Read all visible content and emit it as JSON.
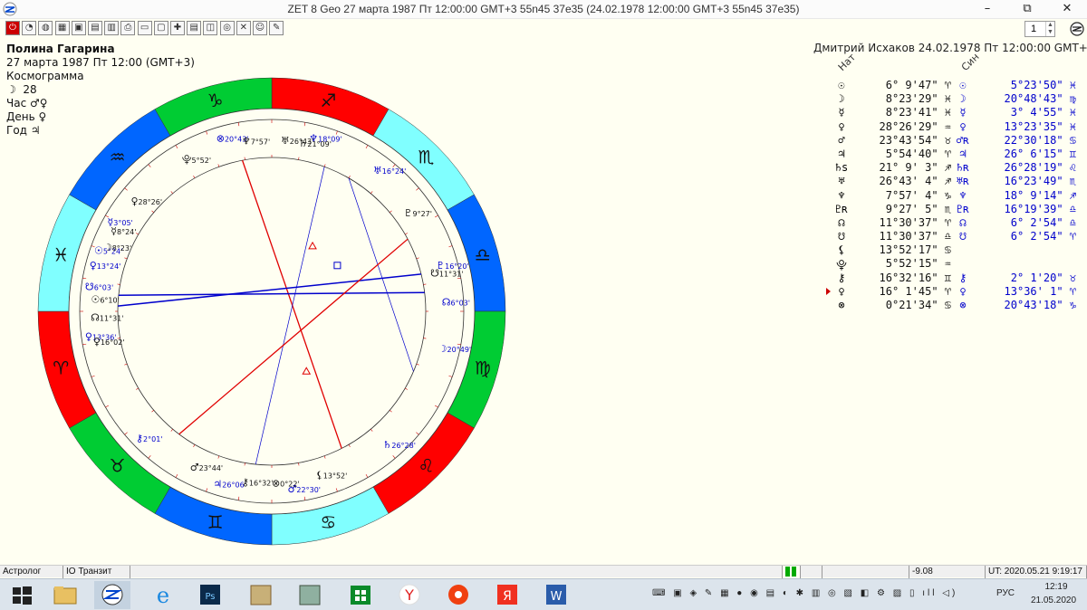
{
  "window": {
    "title": "ZET 8 Geo   27 марта 1987  Пт  12:00:00 GMT+3 55n45  37e35  (24.02.1978  12:00:00 GMT+3 55n45 37e35)",
    "minimize": "–",
    "restore": "⧉",
    "close": "✕"
  },
  "toolbar": {
    "icons": [
      "exit-icon",
      "new-icon",
      "world-icon",
      "table-icon",
      "picture-icon",
      "grid-icon",
      "folder-icon",
      "print-icon",
      "book-icon",
      "window-icon",
      "compass-icon",
      "page-icon",
      "chart-icon",
      "dial-icon",
      "wrench-icon",
      "user-icon",
      "edit-icon"
    ],
    "page_value": "1"
  },
  "left_info": {
    "name": "Полина Гагарина",
    "date": "27 марта 1987  Пт  12:00 (GMT+3)",
    "chart_type": "Космограмма",
    "moon_day_glyph": "☽",
    "moon_day": "28",
    "hour_label": "Час",
    "hour_glyph": "♂♀",
    "day_label": "День",
    "day_glyph": "♀",
    "year_label": "Год",
    "year_glyph": "♃"
  },
  "right_header": {
    "text": "Дмитрий Исхаков 24.02.1978  Пт 12:00:00 GMT+3",
    "col1": "Нат",
    "col2": "Син"
  },
  "planets": [
    {
      "g1": "☉",
      "v1": "6° 9'47\" ♈",
      "g2": "☉",
      "v2": "5°23'50\" ♓"
    },
    {
      "g1": "☽",
      "v1": "8°23'29\" ♓",
      "g2": "☽",
      "v2": "20°48'43\" ♍"
    },
    {
      "g1": "☿",
      "v1": "8°23'41\" ♓",
      "g2": "☿",
      "v2": "3° 4'55\" ♓"
    },
    {
      "g1": "♀",
      "v1": "28°26'29\" ♒",
      "g2": "♀",
      "v2": "13°23'35\" ♓"
    },
    {
      "g1": "♂",
      "v1": "23°43'54\" ♉",
      "g2": "♂ʀ",
      "v2": "22°30'18\" ♋"
    },
    {
      "g1": "♃",
      "v1": "5°54'40\" ♈",
      "g2": "♃",
      "v2": "26° 6'15\" ♊"
    },
    {
      "g1": "♄s",
      "v1": "21° 9' 3\" ♐",
      "g2": "♄ʀ",
      "v2": "26°28'19\" ♌"
    },
    {
      "g1": "♅",
      "v1": "26°43' 4\" ♐",
      "g2": "♅ʀ",
      "v2": "16°23'49\" ♏"
    },
    {
      "g1": "♆",
      "v1": "7°57' 4\" ♑",
      "g2": "♆",
      "v2": "18° 9'14\" ♐"
    },
    {
      "g1": "♇ʀ",
      "v1": "9°27' 5\" ♏",
      "g2": "♇ʀ",
      "v2": "16°19'39\" ♎"
    },
    {
      "g1": "☊",
      "v1": "11°30'37\" ♈",
      "g2": "☊",
      "v2": "6° 2'54\" ♎"
    },
    {
      "g1": "☋",
      "v1": "11°30'37\" ♎",
      "g2": "☋",
      "v2": "6° 2'54\" ♈"
    },
    {
      "g1": "⚸",
      "v1": "13°52'17\" ♋",
      "g2": "",
      "v2": ""
    },
    {
      "g1": "⯓",
      "v1": "5°52'15\" ♒",
      "g2": "",
      "v2": ""
    },
    {
      "g1": "⚷",
      "v1": "16°32'16\" ♊",
      "g2": "⚷",
      "v2": "2° 1'20\" ♉"
    },
    {
      "g1": "♀",
      "v1": "16° 1'45\" ♈",
      "g2": "♀",
      "v2": "13°36' 1\" ♈"
    },
    {
      "g1": "⊗",
      "v1": "0°21'34\" ♋",
      "g2": "⊗",
      "v2": "20°43'18\" ♑"
    }
  ],
  "wheel": {
    "signs": [
      {
        "glyph": "♐",
        "color": "#ff0000"
      },
      {
        "glyph": "♏",
        "color": "#80ffff"
      },
      {
        "glyph": "♎",
        "color": "#0066ff"
      },
      {
        "glyph": "♍",
        "color": "#00cc33"
      },
      {
        "glyph": "♌",
        "color": "#ff0000"
      },
      {
        "glyph": "♋",
        "color": "#80ffff"
      },
      {
        "glyph": "♊",
        "color": "#0066ff"
      },
      {
        "glyph": "♉",
        "color": "#00cc33"
      },
      {
        "glyph": "♈",
        "color": "#ff0000"
      },
      {
        "glyph": "♓",
        "color": "#80ffff"
      },
      {
        "glyph": "♒",
        "color": "#0066ff"
      },
      {
        "glyph": "♑",
        "color": "#00cc33"
      }
    ],
    "outer_labels": [
      {
        "glyph": "♆",
        "text": "18°09'"
      },
      {
        "glyph": "⊗",
        "text": "20°43'"
      },
      {
        "glyph": "♅",
        "text": "16°24'"
      },
      {
        "glyph": "♇",
        "text": "16°20'"
      },
      {
        "glyph": "☊",
        "text": "6°03'"
      },
      {
        "glyph": "☽",
        "text": "20°49'"
      },
      {
        "glyph": "♄",
        "text": "26°28'"
      },
      {
        "glyph": "♂",
        "text": "22°30'"
      },
      {
        "glyph": "♃",
        "text": "26°06'"
      },
      {
        "glyph": "⚷",
        "text": "2°01'"
      },
      {
        "glyph": "♀",
        "text": "13°36'"
      },
      {
        "glyph": "☋",
        "text": "6°03'"
      },
      {
        "glyph": "♀",
        "text": "13°24'"
      },
      {
        "glyph": "☉",
        "text": "5°24'"
      },
      {
        "glyph": "☿",
        "text": "3°05'"
      }
    ],
    "inner_labels": [
      {
        "glyph": "♆",
        "text": "7°57'"
      },
      {
        "glyph": "♅",
        "text": "26°43'"
      },
      {
        "glyph": "♄",
        "text": "21°09'"
      },
      {
        "glyph": "⯓",
        "text": "5°52'"
      },
      {
        "glyph": "♇",
        "text": "9°27'"
      },
      {
        "glyph": "☋",
        "text": "11°31'"
      },
      {
        "glyph": "♀",
        "text": "28°26'"
      },
      {
        "glyph": "☿",
        "text": "8°24'"
      },
      {
        "glyph": "☽",
        "text": "8°23'"
      },
      {
        "glyph": "☉",
        "text": "6°10'"
      },
      {
        "glyph": "☊",
        "text": "11°31'"
      },
      {
        "glyph": "♀",
        "text": "16°02'"
      },
      {
        "glyph": "♂",
        "text": "23°44'"
      },
      {
        "glyph": "⚷",
        "text": "16°32'"
      },
      {
        "glyph": "⊗",
        "text": "0°22'"
      },
      {
        "glyph": "⚸",
        "text": "13°52'"
      }
    ]
  },
  "status": {
    "left": "Астролог",
    "mode": "IO Транзит",
    "value": "-9.08",
    "ut": "UT: 2020.05.21  9:19:17"
  },
  "taskbar": {
    "lang": "РУС",
    "time": "12:19",
    "date": "21.05.2020"
  },
  "colors": {
    "background": "#fffff2",
    "red": "#ff0000",
    "cyan": "#80ffff",
    "blue": "#0066ff",
    "green": "#00cc33",
    "aspect_red": "#e00000",
    "aspect_blue": "#0000cc"
  }
}
